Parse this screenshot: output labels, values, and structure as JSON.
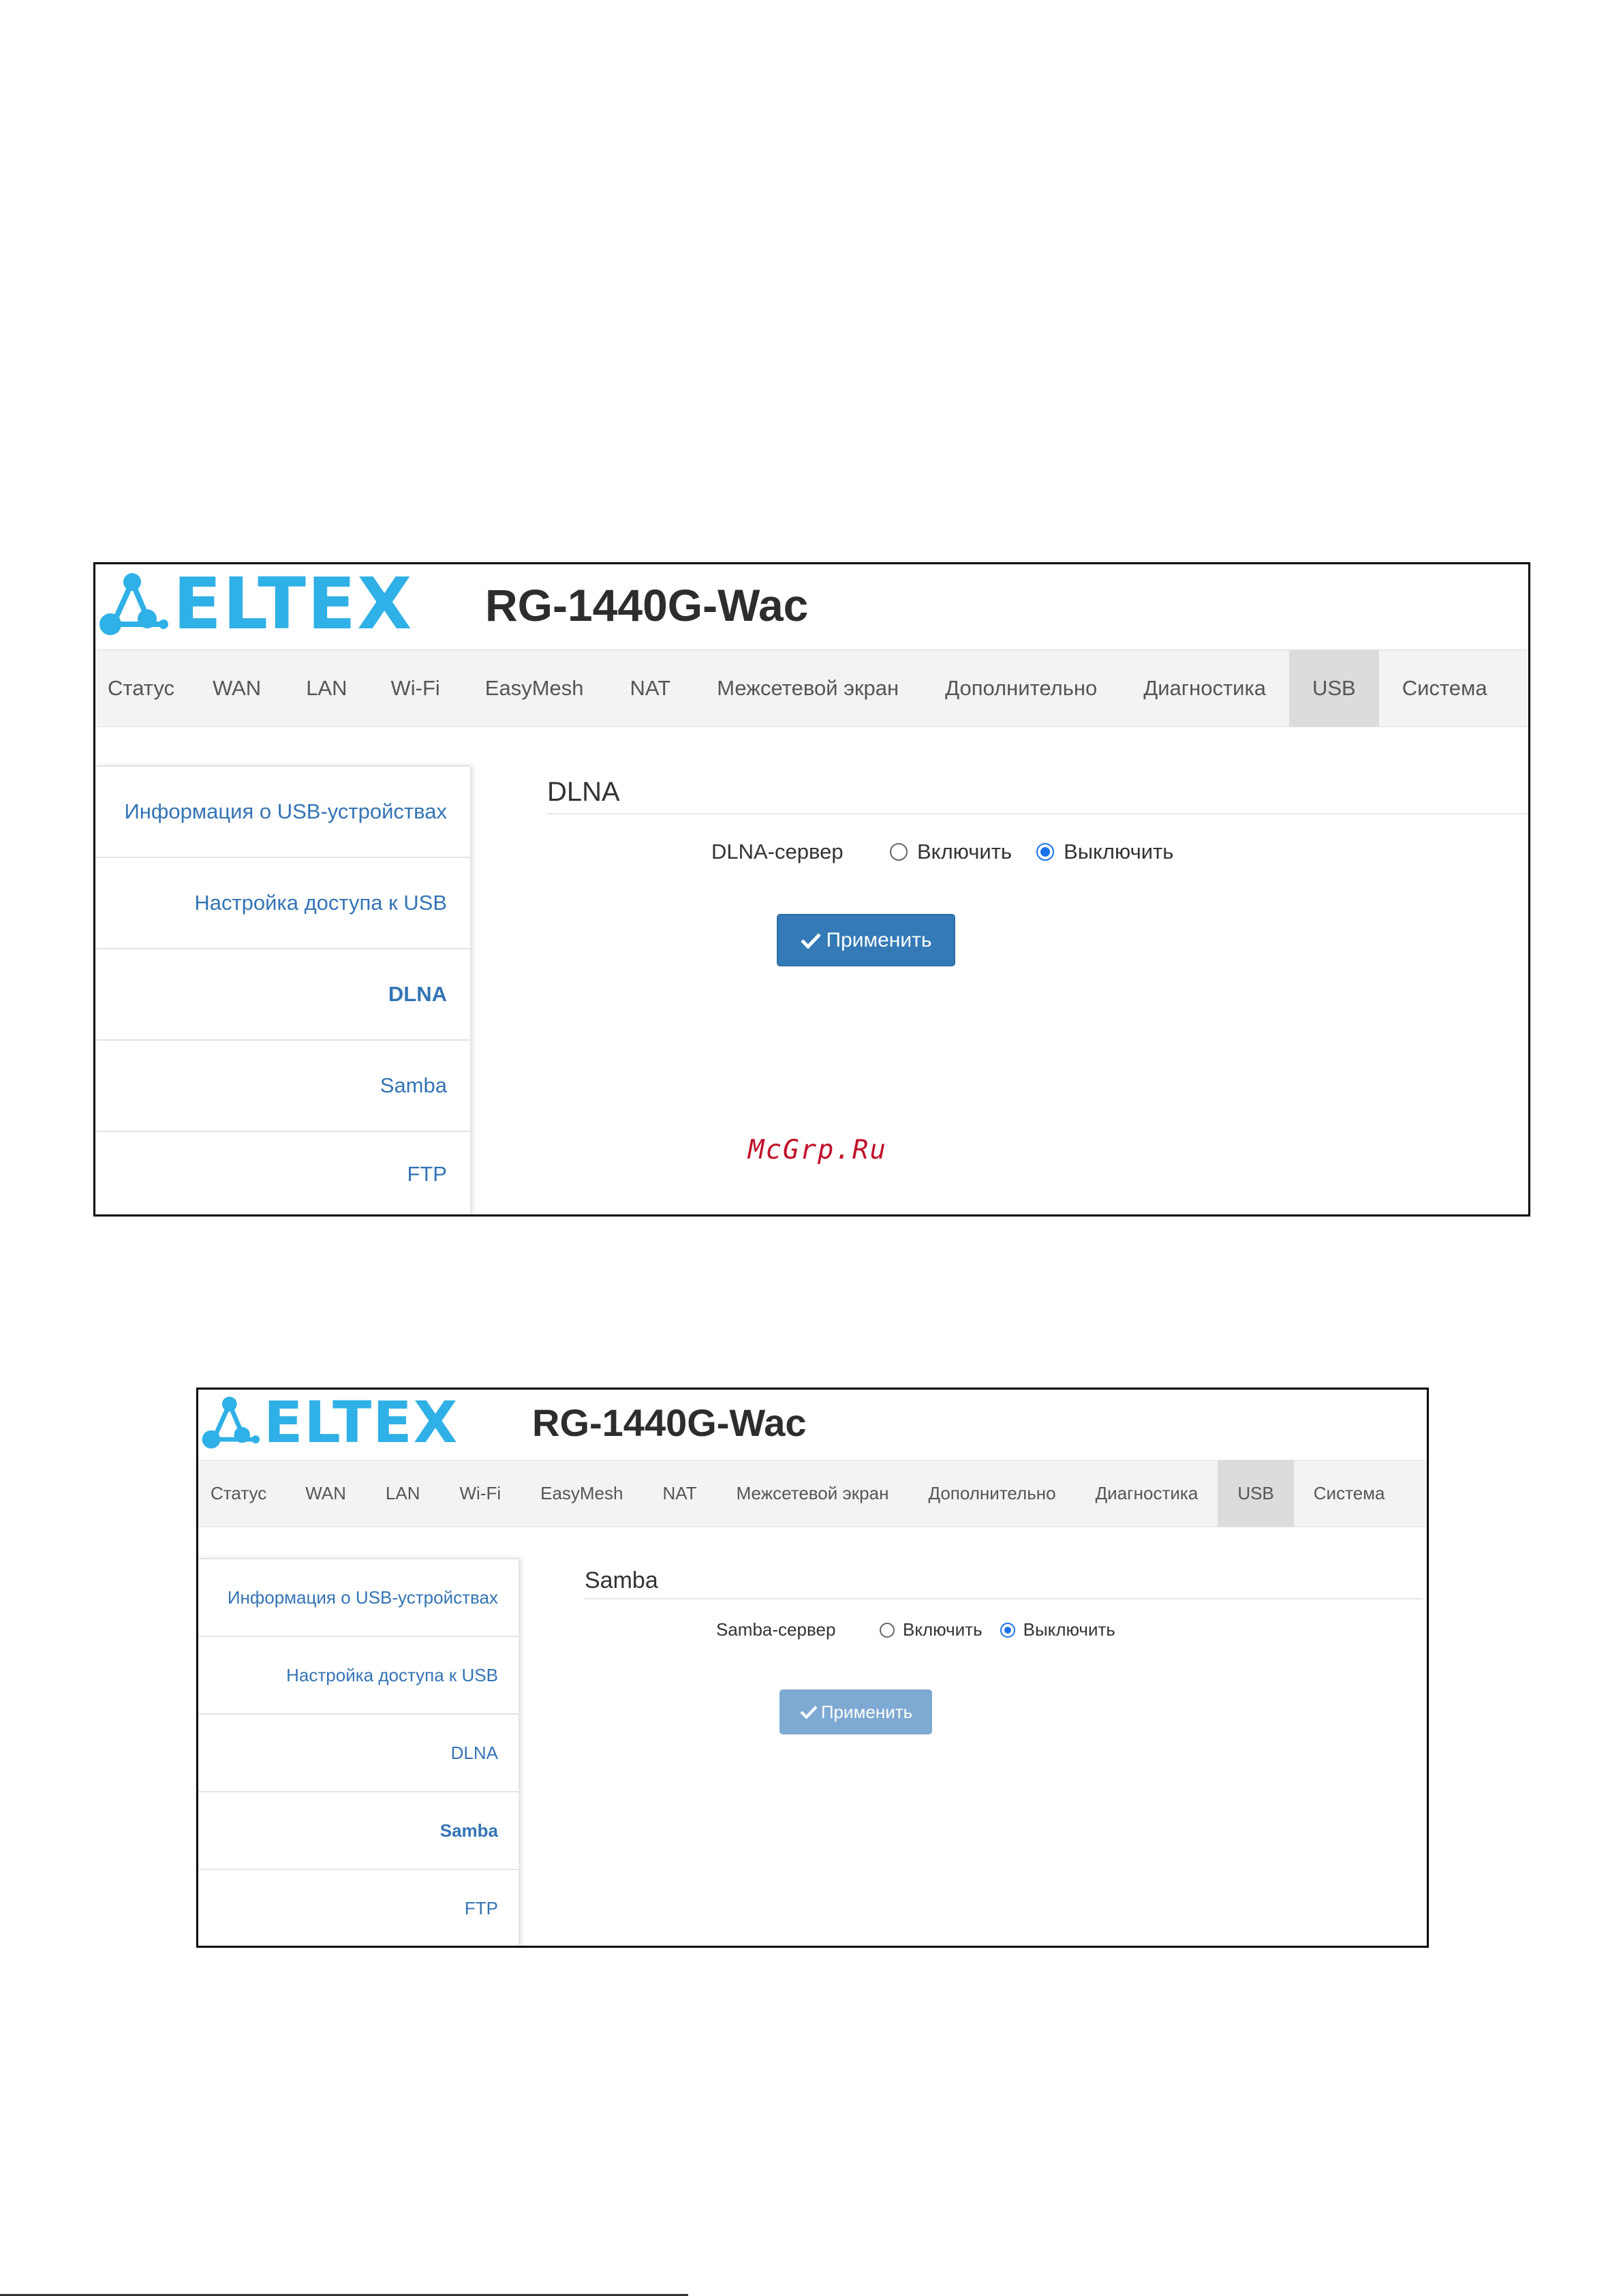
{
  "screens": [
    {
      "logo_text": "ELTEX",
      "model": "RG-1440G-Wac",
      "nav": [
        "Статус",
        "WAN",
        "LAN",
        "Wi-Fi",
        "EasyMesh",
        "NAT",
        "Межсетевой экран",
        "Дополнительно",
        "Диагностика",
        "USB",
        "Система"
      ],
      "nav_active": "USB",
      "sidebar": [
        "Информация о USB-устройствах",
        "Настройка доступа к USB",
        "DLNA",
        "Samba",
        "FTP"
      ],
      "sidebar_active": "DLNA",
      "section_title": "DLNA",
      "field_label": "DLNA-сервер",
      "option_on": "Включить",
      "option_off": "Выключить",
      "selected": "Выключить",
      "apply_label": "Применить",
      "watermark": "McGrp.Ru"
    },
    {
      "logo_text": "ELTEX",
      "model": "RG-1440G-Wac",
      "nav": [
        "Статус",
        "WAN",
        "LAN",
        "Wi-Fi",
        "EasyMesh",
        "NAT",
        "Межсетевой экран",
        "Дополнительно",
        "Диагностика",
        "USB",
        "Система"
      ],
      "nav_active": "USB",
      "sidebar": [
        "Информация о USB-устройствах",
        "Настройка доступа к USB",
        "DLNA",
        "Samba",
        "FTP"
      ],
      "sidebar_active": "Samba",
      "section_title": "Samba",
      "field_label": "Samba-сервер",
      "option_on": "Включить",
      "option_off": "Выключить",
      "selected": "Выключить",
      "apply_label": "Применить"
    }
  ],
  "colors": {
    "logo": "#2fb0e6",
    "link": "#3474b5",
    "button": "#337ab7",
    "button_disabled": "#7ea9d2",
    "watermark": "#c0102a"
  },
  "icons": {
    "apply": "check-icon",
    "logo_mark": "network-nodes-icon"
  }
}
